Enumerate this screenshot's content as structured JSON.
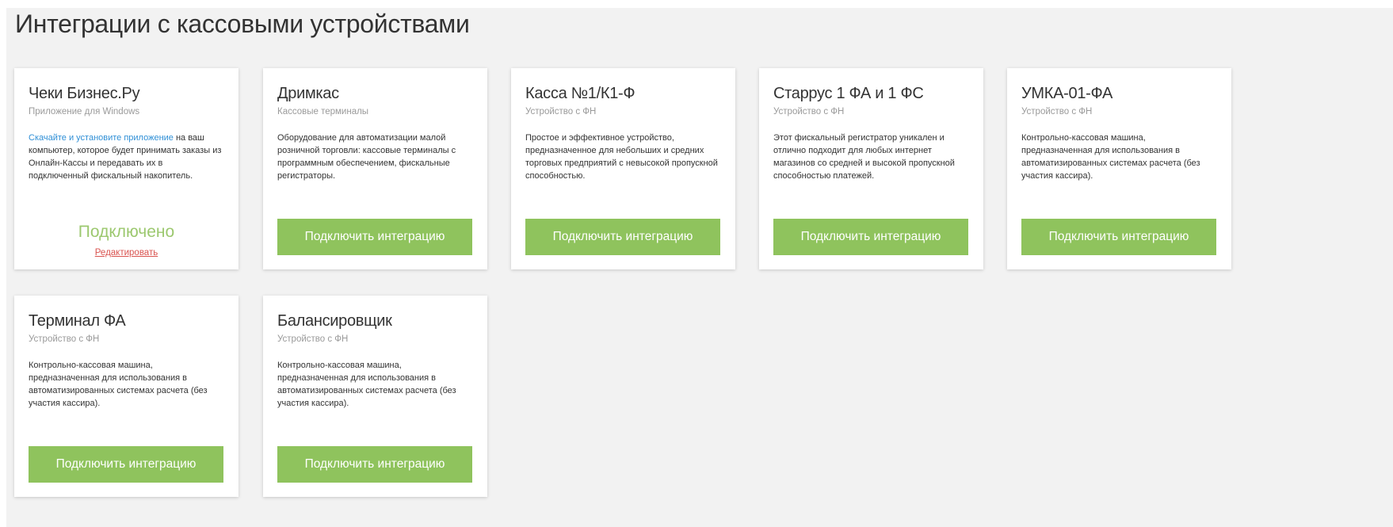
{
  "page": {
    "title": "Интеграции с кассовыми устройствами"
  },
  "colors": {
    "panel_background": "#f2f2f2",
    "button_green": "#8fc35d",
    "connected_green": "#9cc86f",
    "link_blue": "#2f8fd6",
    "edit_red": "#d9534f"
  },
  "cards": [
    {
      "title": "Чеки Бизнес.Ру",
      "subtitle": "Приложение для Windows",
      "description_link": "Скачайте и установите приложение",
      "description": " на ваш компьютер, которое будет принимать заказы из Онлайн-Кассы и передавать их в подключенный фискальный накопитель.",
      "status": "Подключено",
      "edit_label": "Редактировать"
    },
    {
      "title": "Дримкас",
      "subtitle": "Кассовые терминалы",
      "description": "Оборудование для автоматизации малой розничной торговли: кассовые терминалы с программным обеспечением, фискальные регистраторы.",
      "button": "Подключить интеграцию"
    },
    {
      "title": "Касса №1/К1-Ф",
      "subtitle": "Устройство с ФН",
      "description": "Простое и эффективное устройство, предназначенное для небольших и средних торговых предприятий с невысокой пропускной способностью.",
      "button": "Подключить интеграцию"
    },
    {
      "title": "Старрус 1 ФА и 1 ФС",
      "subtitle": "Устройство с ФН",
      "description": "Этот фискальный регистратор уникален и отлично подходит для любых интернет магазинов со средней и высокой пропускной способностью платежей.",
      "button": "Подключить интеграцию"
    },
    {
      "title": "УМКА-01-ФА",
      "subtitle": "Устройство с ФН",
      "description": "Контрольно-кассовая машина, предназначенная для использования в автоматизированных системах расчета (без участия кассира).",
      "button": "Подключить интеграцию"
    },
    {
      "title": "Терминал ФА",
      "subtitle": "Устройство с ФН",
      "description": "Контрольно-кассовая машина, предназначенная для использования в автоматизированных системах расчета (без участия кассира).",
      "button": "Подключить интеграцию"
    },
    {
      "title": "Балансировщик",
      "subtitle": "Устройство с ФН",
      "description": "Контрольно-кассовая машина, предназначенная для использования в автоматизированных системах расчета (без участия кассира).",
      "button": "Подключить интеграцию"
    }
  ]
}
